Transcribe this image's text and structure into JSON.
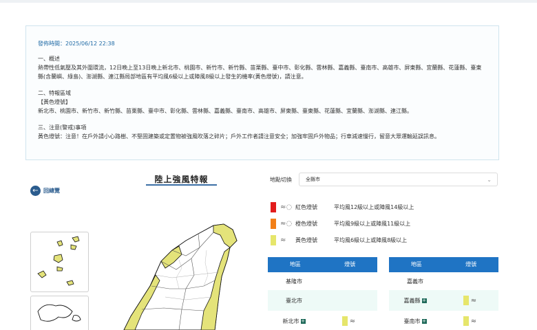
{
  "notice": {
    "time": "發佈時間：2025/06/12 22:38",
    "overview_heading": "一、概述",
    "overview_text": "熱帶性低氣壓及其外圍環流，12日晚上至13日晚上新北市、桃園市、新竹市、新竹縣、苗栗縣、臺中市、彰化縣、雲林縣、嘉義縣、臺南市、高雄市、屏東縣、宜蘭縣、花蓮縣、臺東縣(含蘭嶼、綠島)、澎湖縣、連江縣局部地區有平均風6級以上或陣風8級以上發生的機率(黃色燈號)，請注意。",
    "area_heading": "二、特報區域",
    "area_sub": "【黃色燈號】",
    "area_text": "新北市、桃園市、新竹市、新竹縣、苗栗縣、臺中市、彰化縣、雲林縣、嘉義縣、臺南市、高雄市、屏東縣、臺東縣、花蓮縣、宜蘭縣、澎湖縣、連江縣。",
    "caution_heading": "三、注意(警戒)事項",
    "caution_text": "黃色燈號：注意！在戶外請小心路樹、不堅固建築或定置物被強風吹落之碎片；戶外工作者請注意安全；加強牢固戶外物品；行車減速慢行，留意大眾運輸延誤訊息。"
  },
  "page_title": "陸上強風特報",
  "back_label": "回總覽",
  "back_icon": "arrow-left-icon",
  "location": {
    "label": "地點切換",
    "selected": "全縣市"
  },
  "legend": [
    {
      "color": "#e21c1c",
      "name": "紅色燈號",
      "desc": "平均風12級以上或陣風14級以上"
    },
    {
      "color": "#f27f18",
      "name": "橙色燈號",
      "desc": "平均風9級以上或陣風11級以上"
    },
    {
      "color": "#e6e66b",
      "name": "黃色燈號",
      "desc": "平均風6級以上或陣風8級以上"
    }
  ],
  "table": {
    "col_area": "地區",
    "col_signal": "燈號",
    "left_rows": [
      {
        "area": "基隆市",
        "signal": ""
      },
      {
        "area": "臺北市",
        "signal": ""
      },
      {
        "area": "新北市",
        "signal": "yellow"
      }
    ],
    "right_rows": [
      {
        "area": "嘉義市",
        "signal": ""
      },
      {
        "area": "嘉義縣",
        "signal": "yellow"
      },
      {
        "area": "臺南市",
        "signal": "yellow"
      }
    ]
  },
  "colors": {
    "accent": "#1f74c4",
    "yellow": "#e6e66b",
    "map_yellow": "#e4e37a"
  }
}
